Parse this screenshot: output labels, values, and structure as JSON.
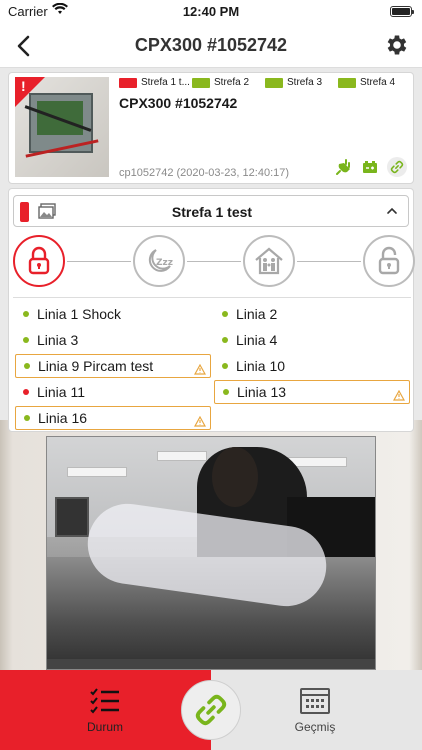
{
  "status_bar": {
    "carrier": "Carrier",
    "time": "12:40 PM"
  },
  "nav": {
    "title": "CPX300 #1052742"
  },
  "device": {
    "name": "CPX300 #1052742",
    "meta": "cp1052742 (2020-03-23, 12:40:17)",
    "alert_mark": "!",
    "zones": [
      {
        "label": "Strefa 1 t...",
        "color": "#e8202a"
      },
      {
        "label": "Strefa 2",
        "color": "#8ab81e"
      },
      {
        "label": "Strefa 3",
        "color": "#8ab81e"
      },
      {
        "label": "Strefa 4",
        "color": "#8ab81e"
      }
    ],
    "status_icons": [
      "power-plug-icon",
      "battery-icon",
      "link-icon"
    ],
    "status_color": "#79b51c"
  },
  "zone_panel": {
    "selected_zone": "Strefa 1 test",
    "modes": [
      {
        "name": "armed-lock",
        "active": true
      },
      {
        "name": "night-sleep",
        "active": false
      },
      {
        "name": "home-family",
        "active": false
      },
      {
        "name": "disarmed-unlock",
        "active": false
      }
    ],
    "lines": [
      {
        "label": "Linia 1 Shock",
        "dot": "#8ab81e",
        "warning": false
      },
      {
        "label": "Linia 2",
        "dot": "#8ab81e",
        "warning": false
      },
      {
        "label": "Linia 3",
        "dot": "#8ab81e",
        "warning": false
      },
      {
        "label": "Linia 4",
        "dot": "#8ab81e",
        "warning": false
      },
      {
        "label": "Linia 9 Pircam test",
        "dot": "#8ab81e",
        "warning": true
      },
      {
        "label": "Linia 10",
        "dot": "#8ab81e",
        "warning": false
      },
      {
        "label": "Linia 11",
        "dot": "#e8202a",
        "warning": false
      },
      {
        "label": "Linia 13",
        "dot": "#8ab81e",
        "warning": true
      },
      {
        "label": "Linia 16",
        "dot": "#8ab81e",
        "warning": true
      }
    ]
  },
  "tabs": {
    "status_label": "Durum",
    "history_label": "Geçmiş"
  },
  "colors": {
    "accent": "#e8202a",
    "ok": "#8ab81e",
    "warning": "#e8a640"
  }
}
